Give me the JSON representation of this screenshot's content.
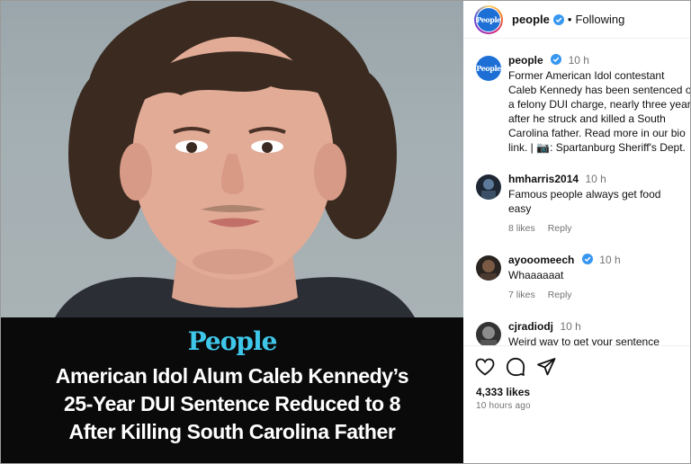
{
  "post_image": {
    "brand": "People",
    "headline_lines": [
      "American Idol Alum Caleb Kennedy’s",
      "25-Year DUI Sentence Reduced to 8",
      "After Killing South Carolina Father"
    ]
  },
  "header": {
    "avatar_text": "People",
    "username": "people",
    "separator": "•",
    "follow_state": "Following"
  },
  "caption": {
    "avatar_text": "People",
    "username": "people",
    "time": "10 h",
    "lines": [
      "Former American Idol contestant",
      "Caleb Kennedy has been sentenced on",
      "a felony DUI charge, nearly three years",
      "after he struck and killed a South",
      "Carolina father. Read more in our bio",
      "link. | 📷: Spartanburg Sheriff's Dept."
    ]
  },
  "comments": [
    {
      "username": "hmharris2014",
      "verified": false,
      "time": "10 h",
      "text": "Famous people always get food",
      "text2": "easy",
      "likes": "8 likes",
      "reply": "Reply"
    },
    {
      "username": "ayooomeech",
      "verified": true,
      "time": "10 h",
      "text": "Whaaaaaat",
      "text2": "",
      "likes": "7 likes",
      "reply": "Reply"
    },
    {
      "username": "cjradiodj",
      "verified": false,
      "time": "10 h",
      "text": "Weird way to get your sentence",
      "text2": "",
      "likes": "",
      "reply": ""
    }
  ],
  "actions": {
    "icons": [
      "heart-icon",
      "comment-icon",
      "share-icon"
    ],
    "likes_count": "4,333 likes",
    "posted_ago": "10 hours ago"
  },
  "colors": {
    "brand_cyan": "#3fc7ea",
    "verified_blue": "#3897f0",
    "people_avatar_blue": "#1d6fd6",
    "muted_text": "#737373"
  }
}
